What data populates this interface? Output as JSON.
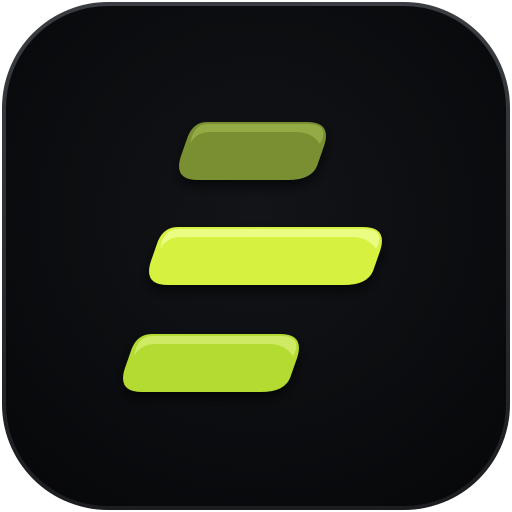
{
  "icon": {
    "name": "app-icon",
    "colors": {
      "tile": "#0d0f12",
      "tile_edge": "#2a2d31",
      "bar_top": "#7a8f32",
      "bar_middle": "#d7f13f",
      "bar_bottom": "#b3db32",
      "bar_highlight": "#f2ff9a"
    }
  }
}
